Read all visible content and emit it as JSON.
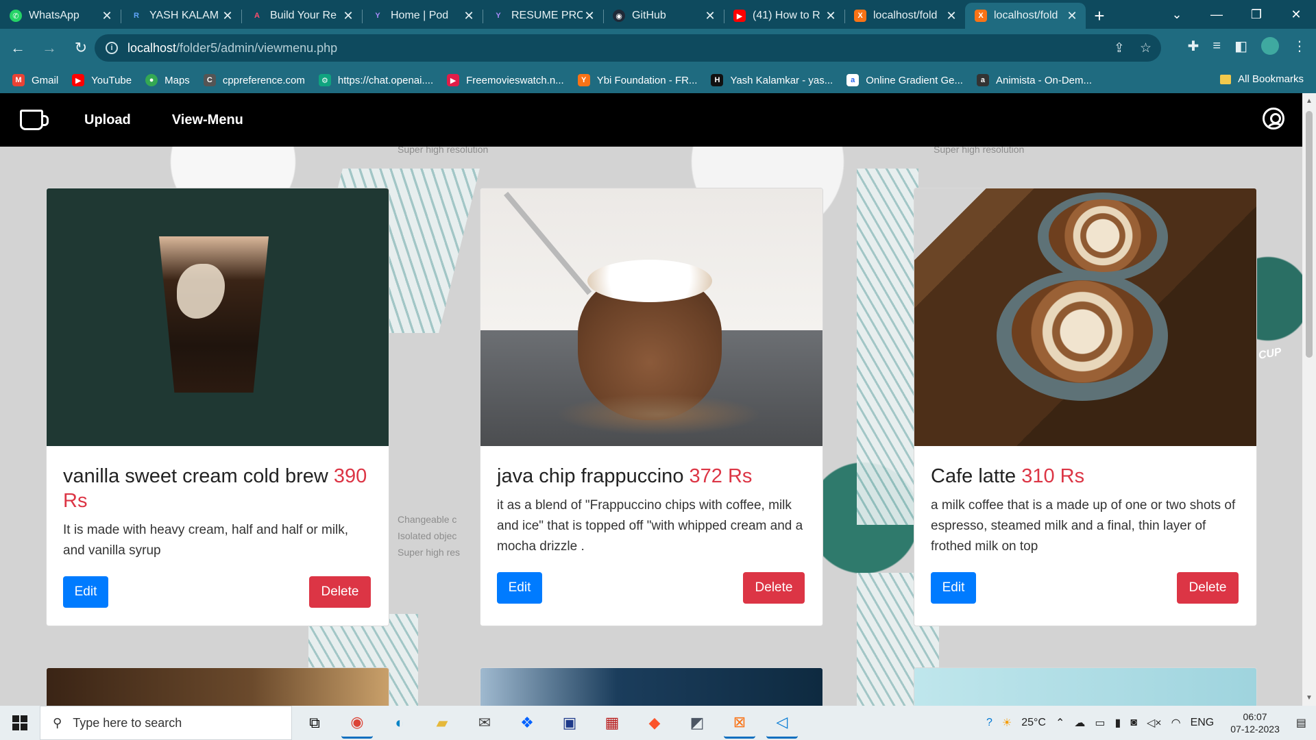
{
  "browser": {
    "tabs": [
      {
        "title": "WhatsApp",
        "icon": "whatsapp-icon",
        "color": "#25d366",
        "glyph": "✆"
      },
      {
        "title": "YASH KALAM",
        "icon": "resume-icon",
        "color": "#2563eb",
        "glyph": "R"
      },
      {
        "title": "Build Your Re",
        "icon": "resume-builder-icon",
        "color": "#e11d48",
        "glyph": "A"
      },
      {
        "title": "Home | Pod",
        "icon": "pod-icon",
        "color": "#6d28d9",
        "glyph": "Y"
      },
      {
        "title": "RESUME PRO",
        "icon": "resume-pro-icon",
        "color": "#6d28d9",
        "glyph": "Y"
      },
      {
        "title": "GitHub",
        "icon": "github-icon",
        "color": "#1f2937",
        "glyph": "◉"
      },
      {
        "title": "(41) How to R",
        "icon": "youtube-icon",
        "color": "#ff0000",
        "glyph": "▶"
      },
      {
        "title": "localhost/fold",
        "icon": "xampp-icon",
        "color": "#f97316",
        "glyph": "X"
      },
      {
        "title": "localhost/fold",
        "icon": "xampp-icon",
        "color": "#f97316",
        "glyph": "X"
      }
    ],
    "url_host": "localhost",
    "url_path": "/folder5/admin/viewmenu.php",
    "bookmarks": [
      {
        "label": "Gmail",
        "icon": "gmail-icon",
        "color": "#ea4335",
        "glyph": "M"
      },
      {
        "label": "YouTube",
        "icon": "youtube-icon",
        "color": "#ff0000",
        "glyph": "▶"
      },
      {
        "label": "Maps",
        "icon": "maps-icon",
        "color": "#34a853",
        "glyph": "●"
      },
      {
        "label": "cppreference.com",
        "icon": "cppreference-icon",
        "color": "#555555",
        "glyph": "C"
      },
      {
        "label": "https://chat.openai....",
        "icon": "openai-icon",
        "color": "#10a37f",
        "glyph": "⚙"
      },
      {
        "label": "Freemovieswatch.n...",
        "icon": "movies-icon",
        "color": "#e11d48",
        "glyph": "▶"
      },
      {
        "label": "Ybi Foundation - FR...",
        "icon": "ybi-icon",
        "color": "#f97316",
        "glyph": "Y"
      },
      {
        "label": "Yash Kalamkar - yas...",
        "icon": "profile-icon",
        "color": "#111111",
        "glyph": "H"
      },
      {
        "label": "Online Gradient Ge...",
        "icon": "gradient-icon",
        "color": "#2563eb",
        "glyph": "a"
      },
      {
        "label": "Animista - On-Dem...",
        "icon": "animista-icon",
        "color": "#333333",
        "glyph": "a"
      }
    ],
    "all_bookmarks": "All Bookmarks"
  },
  "app": {
    "nav": {
      "upload": "Upload",
      "view_menu": "View-Menu"
    },
    "background_labels": {
      "super_high_1": "Super high resolution",
      "super_high_2": "Super high resolution",
      "changeable": "Changeable c",
      "isolated": "Isolated objec",
      "super_high_3": "Super high res",
      "cup_text": "CUP"
    },
    "menu_items": [
      {
        "name": "vanilla sweet cream cold brew",
        "price": "390 Rs",
        "description": "It is made with heavy cream, half and half or milk, and vanilla syrup",
        "edit": "Edit",
        "delete": "Delete"
      },
      {
        "name": "java chip frappuccino",
        "price": "372 Rs",
        "description": "it as a blend of \"Frappuccino chips with coffee, milk and ice\" that is topped off \"with whipped cream and a mocha drizzle .",
        "edit": "Edit",
        "delete": "Delete"
      },
      {
        "name": "Cafe latte",
        "price": "310 Rs",
        "description": "a milk coffee that is a made up of one or two shots of espresso, steamed milk and a final, thin layer of frothed milk on top",
        "edit": "Edit",
        "delete": "Delete"
      }
    ]
  },
  "taskbar": {
    "search_placeholder": "Type here to search",
    "weather": "25°C",
    "language": "ENG",
    "time": "06:07",
    "date": "07-12-2023"
  },
  "colors": {
    "price": "#dc3545",
    "edit_button": "#007bff",
    "delete_button": "#dc3545",
    "browser_frame": "#1f6b80"
  }
}
